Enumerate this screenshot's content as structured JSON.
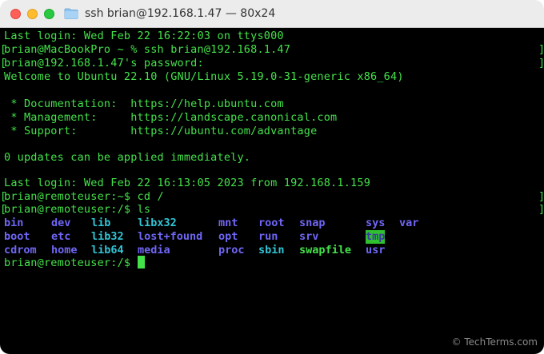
{
  "window": {
    "title": "ssh brian@192.168.1.47  —  80x24"
  },
  "terminal": {
    "lines": [
      "Last login: Wed Feb 22 16:22:03 on ttys000",
      "brian@MacBookPro ~ % ssh brian@192.168.1.47",
      "brian@192.168.1.47's password:",
      "Welcome to Ubuntu 22.10 (GNU/Linux 5.19.0-31-generic x86_64)",
      "",
      " * Documentation:  https://help.ubuntu.com",
      " * Management:     https://landscape.canonical.com",
      " * Support:        https://ubuntu.com/advantage",
      "",
      "0 updates can be applied immediately.",
      "",
      "Last login: Wed Feb 22 16:13:05 2023 from 192.168.1.159",
      "brian@remoteuser:~$ cd /",
      "brian@remoteuser:/$ ls"
    ],
    "ls_rows": [
      [
        "bin",
        "dev",
        "lib",
        "libx32",
        "mnt",
        "root",
        "snap",
        "sys",
        "var"
      ],
      [
        "boot",
        "etc",
        "lib32",
        "lost+found",
        "opt",
        "run",
        "srv",
        "tmp"
      ],
      [
        "cdrom",
        "home",
        "lib64",
        "media",
        "proc",
        "sbin",
        "swapfile",
        "usr"
      ]
    ],
    "prompt": "brian@remoteuser:/$ "
  },
  "watermark": "© TechTerms.com",
  "colors": {
    "text": "#44e24a",
    "directory": "#6f66f5",
    "symlink": "#32c4d4",
    "tmp_highlight": "#2fbf2f"
  }
}
